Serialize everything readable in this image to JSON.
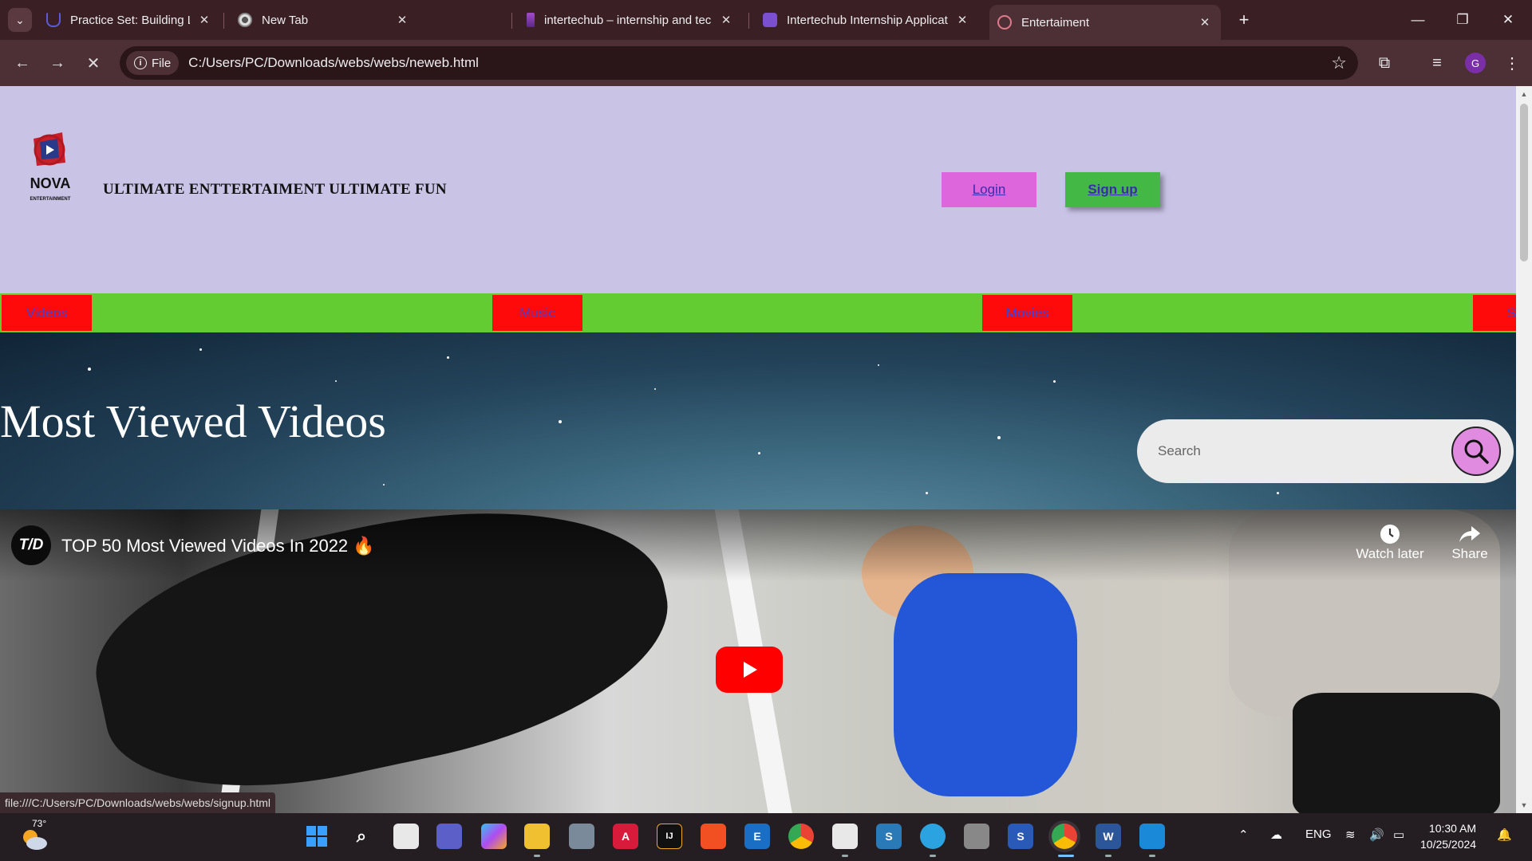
{
  "browser": {
    "tabs": [
      {
        "title": "Practice Set: Building Layouts - ",
        "icon": "udemy-icon",
        "color": "#5b5bd6"
      },
      {
        "title": "New Tab",
        "icon": "chrome-icon",
        "color": "#dddddd"
      },
      {
        "title": "intertechub – internship and tec",
        "icon": "intertechub-icon",
        "color": "#a24cc8"
      },
      {
        "title": "Intertechub Internship Applicati",
        "icon": "forms-icon",
        "color": "#7a4fd0"
      },
      {
        "title": "Entertaiment",
        "icon": "page-icon",
        "color": "#e07a8a"
      }
    ],
    "active_tab": 4,
    "address_chip": "File",
    "url": "C:/Users/PC/Downloads/webs/webs/neweb.html",
    "profile_initial": "G",
    "status_url": "file:///C:/Users/PC/Downloads/webs/webs/signup.html"
  },
  "site": {
    "logo_text": "NOVA",
    "logo_subtext": "ENTERTAINMENT",
    "tagline": "ULTIMATE ENTTERTAIMENT ULTIMATE FUN",
    "login_label": "Login",
    "signup_label": "Sign up",
    "nav": [
      "Videos",
      "Music",
      "Movies",
      "S"
    ],
    "hero_title": "Most Viewed Videos",
    "search_placeholder": "Search",
    "colors": {
      "header_bg": "#c9c3e6",
      "nav_bg": "#63cc33",
      "nav_item_bg": "#ff0a0a",
      "login_bg": "#dd66dd",
      "signup_bg": "#44b844"
    }
  },
  "video": {
    "channel_logo": "T/D",
    "title": "TOP 50 Most Viewed Videos In 2022 🔥",
    "watch_later": "Watch later",
    "share": "Share"
  },
  "taskbar": {
    "temperature": "73°",
    "language": "ENG",
    "time": "10:30 AM",
    "date": "10/25/2024"
  }
}
